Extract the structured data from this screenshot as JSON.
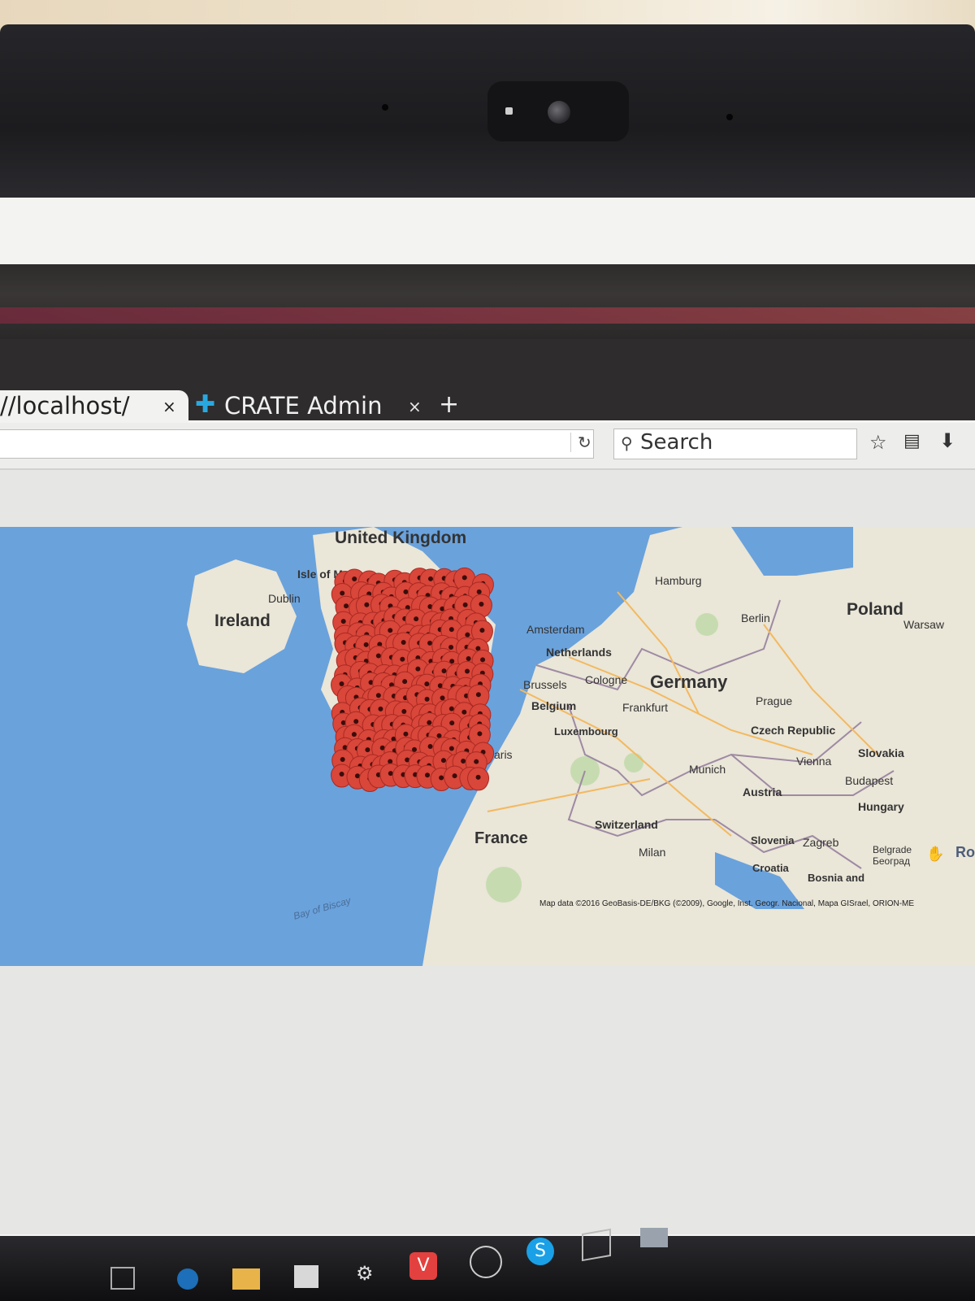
{
  "browser": {
    "tab1": {
      "url_text": "//localhost/",
      "close": "×"
    },
    "tab2": {
      "icon": "crate-plus-icon",
      "title": "CRATE Admin",
      "close": "×"
    },
    "new_tab": "+",
    "search_placeholder": "Search",
    "toolbar_icons": [
      "reload-icon",
      "bookmark-star-icon",
      "reading-list-icon",
      "download-icon"
    ]
  },
  "map": {
    "country_labels": [
      "United Kingdom",
      "Ireland",
      "Poland",
      "Germany",
      "Netherlands",
      "Belgium",
      "France",
      "Czech Republic",
      "Slovakia",
      "Austria",
      "Hungary",
      "Switzerland",
      "Slovenia",
      "Croatia",
      "Luxembourg",
      "Bosnia and"
    ],
    "city_labels": [
      "Isle of Man",
      "Dublin",
      "Hamburg",
      "Berlin",
      "Warsaw",
      "Amsterdam",
      "Brussels",
      "Cologne",
      "Frankfurt",
      "Prague",
      "Vienna",
      "Budapest",
      "Munich",
      "Zagreb",
      "Milan",
      "Belgrade",
      "Београд",
      "aris"
    ],
    "water_labels": [
      "Bay of Biscay"
    ],
    "attribution": "Map data ©2016 GeoBasis-DE/BKG (©2009), Google, Inst. Geogr. Nacional, Mapa GISrael, ORION-ME",
    "partial_label": "Ro",
    "marker_color": "#d9463a"
  },
  "taskbar": {
    "icons": [
      "task-view-icon",
      "edge-icon",
      "file-explorer-icon",
      "store-icon",
      "unity-icon",
      "vivaldi-icon",
      "app-icon",
      "skype-icon",
      "box-icon",
      "network-icon"
    ]
  }
}
